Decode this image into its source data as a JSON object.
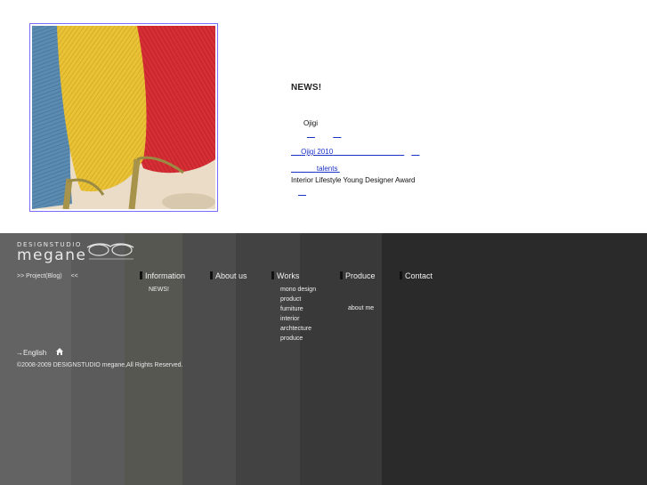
{
  "news": {
    "title": "NEWS!",
    "line1": "Ojigi",
    "line2a": "__",
    "line2b": "__",
    "line3": "Ojigi   2010",
    "line3_gap": "                                    ",
    "line3_tail": "__",
    "line4_pad": "             ",
    "line4": "talents",
    "line4_tail": " ",
    "line5": "Interior Lifestyle Young Designer Award",
    "line6": "__"
  },
  "footer": {
    "logo_small": "DESIGNSTUDIO",
    "logo_big": "megane",
    "logo_glasses_label": "glasses-logo-icon",
    "project_link": ">> Project(Blog)",
    "project_arrow": "<<",
    "nav": [
      {
        "label": "Information"
      },
      {
        "label": "About us"
      },
      {
        "label": "Works"
      },
      {
        "label": "Produce"
      },
      {
        "label": "Contact"
      }
    ],
    "information_items": [
      "NEWS!"
    ],
    "works_items": [
      "mono design",
      "product",
      "furniture",
      "interior",
      "archtecture",
      "produce"
    ],
    "produce_items": [
      "about me"
    ],
    "language": "→English",
    "home_icon": "home-icon",
    "copyright": "©2008-2009 DESIGNSTUDIO megane,All Rights Reserved."
  },
  "colors": {
    "link": "#1c30c8",
    "footer_bg": "#2b2b2b",
    "frame": "#7a6cff"
  }
}
